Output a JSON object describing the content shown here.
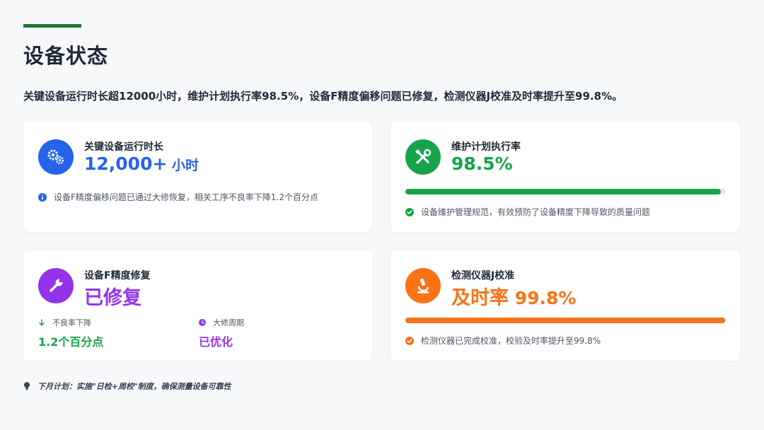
{
  "header": {
    "title": "设备状态",
    "summary": "关键设备运行时长超12000小时，维护计划执行率98.5%，设备F精度偏移问题已修复，检测仪器J校准及时率提升至99.8%。"
  },
  "colors": {
    "accent_green": "#1e7a34",
    "blue": "#2563eb",
    "green": "#16a34a",
    "purple": "#9333ea",
    "orange": "#f97316"
  },
  "cards": [
    {
      "label": "关键设备运行时长",
      "value": "12,000+",
      "unit": " 小时",
      "icon": "gears-icon",
      "note_icon": "info-icon",
      "note": "设备F精度偏移问题已通过大修恢复，相关工序不良率下降1.2个百分点"
    },
    {
      "label": "维护计划执行率",
      "value": "98.5%",
      "icon": "tools-icon",
      "progress": 0.985,
      "note_icon": "check-circle-icon",
      "note": "设备维护管理规范，有效预防了设备精度下降导致的质量问题"
    },
    {
      "label": "设备F精度修复",
      "value": "已修复",
      "icon": "wrench-icon",
      "metrics": [
        {
          "icon": "arrow-down-icon",
          "label": "不良率下降",
          "value": "1.2个百分点"
        },
        {
          "icon": "clock-icon",
          "label": "大修周期",
          "value": "已优化"
        }
      ]
    },
    {
      "label": "检测仪器J校准",
      "value_prefix": "及时率",
      "value": " 99.8%",
      "icon": "microscope-icon",
      "progress": 0.998,
      "note_icon": "check-circle-icon",
      "note": "检测仪器已完成校准，校验及时率提升至99.8%"
    }
  ],
  "footer": {
    "icon": "lightbulb-icon",
    "text": "下月计划：实施\"日检+周校\"制度，确保测量设备可靠性"
  }
}
